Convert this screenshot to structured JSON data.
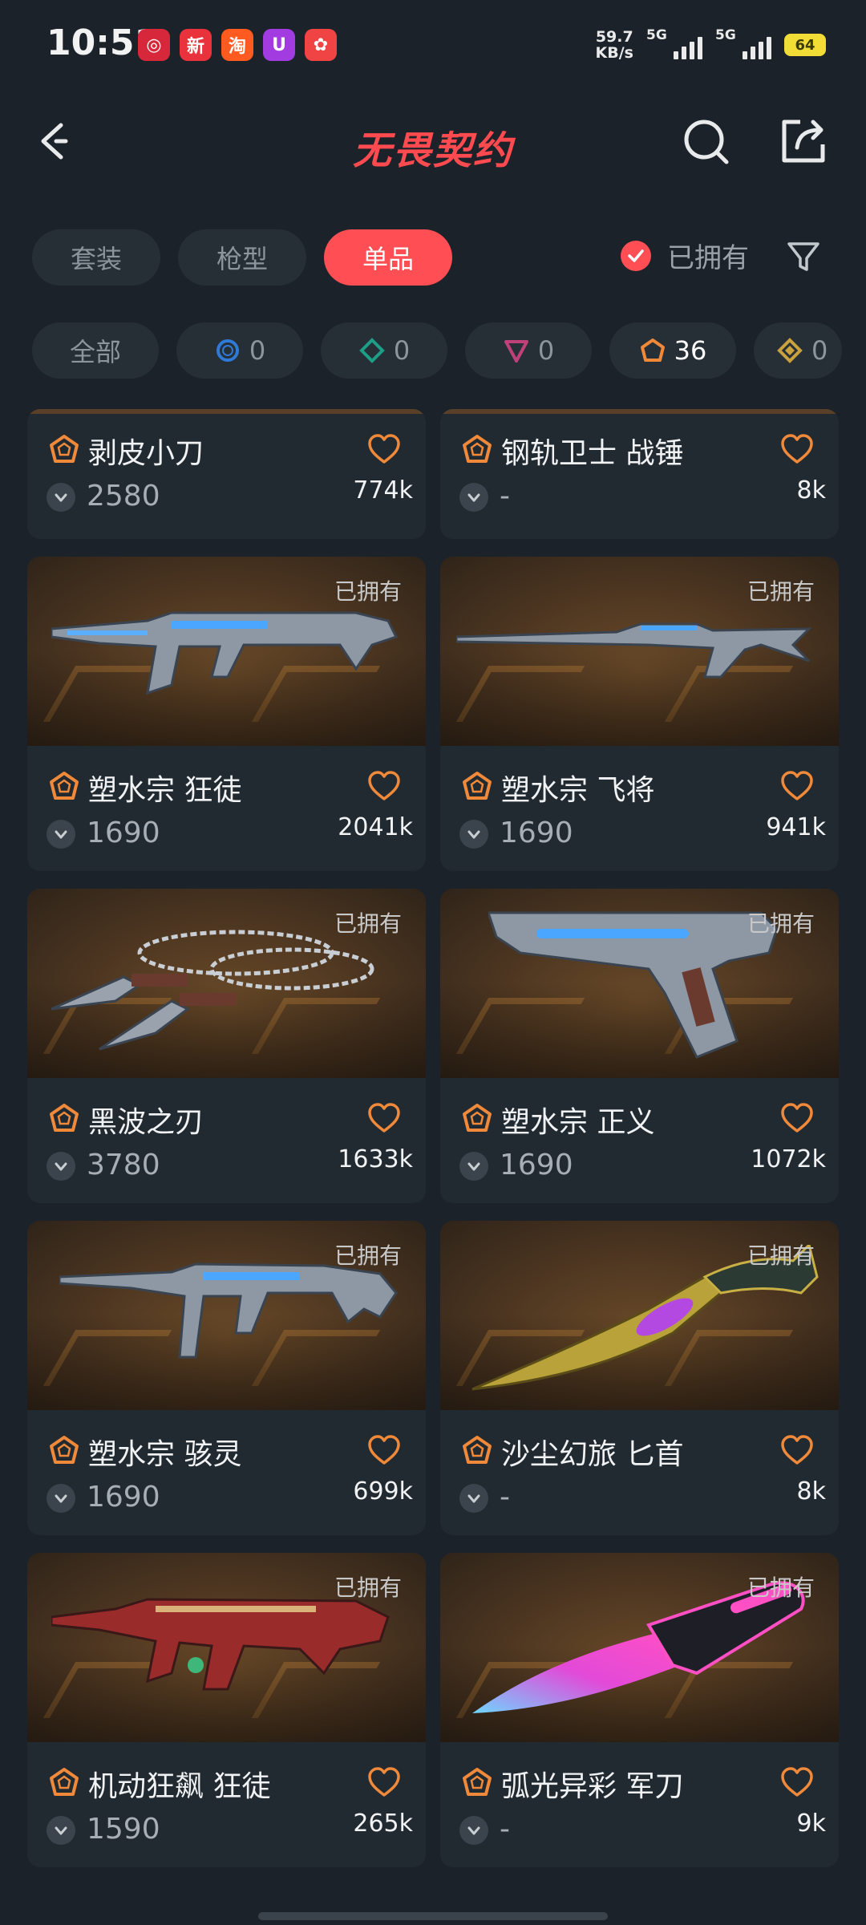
{
  "status_bar": {
    "time": "10:51",
    "apps": [
      {
        "name": "bank-app-icon",
        "glyph": "◎",
        "color": "#d6283a"
      },
      {
        "name": "news-app-icon",
        "glyph": "新",
        "color": "#e9323b"
      },
      {
        "name": "taobao-app-icon",
        "glyph": "淘",
        "color": "#ff5a1f"
      },
      {
        "name": "u-app-icon",
        "glyph": "U",
        "color": "#a23be0"
      },
      {
        "name": "game-app-icon",
        "glyph": "✿",
        "color": "#f04343"
      }
    ],
    "net_speed_value": "59.7",
    "net_speed_unit": "KB/s",
    "signal_1_label": "5G",
    "signal_2_label": "5G",
    "battery": "64"
  },
  "header": {
    "title": "无畏契约"
  },
  "type_tabs": [
    "套装",
    "枪型",
    "单品"
  ],
  "active_type_tab": 2,
  "owned_filter_label": "已拥有",
  "tier_chips": [
    {
      "label": "全部",
      "icon": "",
      "count": ""
    },
    {
      "label": "",
      "icon": "select-tier-icon",
      "color": "#2f7ad6",
      "count": "0"
    },
    {
      "label": "",
      "icon": "deluxe-tier-icon",
      "color": "#1d9e86",
      "count": "0"
    },
    {
      "label": "",
      "icon": "premium-tier-icon",
      "color": "#c0417a",
      "count": "0"
    },
    {
      "label": "",
      "icon": "exclusive-tier-icon",
      "color": "#f08a3a",
      "count": "36"
    },
    {
      "label": "",
      "icon": "ultra-tier-icon",
      "color": "#c9a23e",
      "count": "0"
    }
  ],
  "items": [
    {
      "name": "剥皮小刀",
      "price": "2580",
      "favorites": "774k",
      "owned_label": ""
    },
    {
      "name": "钢轨卫士 战锤",
      "price": "-",
      "favorites": "8k",
      "owned_label": ""
    },
    {
      "name": "塑水宗 狂徒",
      "price": "1690",
      "favorites": "2041k",
      "owned_label": "已拥有",
      "art": "rifle"
    },
    {
      "name": "塑水宗 飞将",
      "price": "1690",
      "favorites": "941k",
      "owned_label": "已拥有",
      "art": "sniper"
    },
    {
      "name": "黑波之刃",
      "price": "3780",
      "favorites": "1633k",
      "owned_label": "已拥有",
      "art": "kunai"
    },
    {
      "name": "塑水宗 正义",
      "price": "1690",
      "favorites": "1072k",
      "owned_label": "已拥有",
      "art": "pistol"
    },
    {
      "name": "塑水宗 骇灵",
      "price": "1690",
      "favorites": "699k",
      "owned_label": "已拥有",
      "art": "smg"
    },
    {
      "name": "沙尘幻旅 匕首",
      "price": "-",
      "favorites": "8k",
      "owned_label": "已拥有",
      "art": "dagger"
    },
    {
      "name": "机动狂飙 狂徒",
      "price": "1590",
      "favorites": "265k",
      "owned_label": "已拥有",
      "art": "redrifle"
    },
    {
      "name": "弧光异彩 军刀",
      "price": "-",
      "favorites": "9k",
      "owned_label": "已拥有",
      "art": "pinkknife"
    }
  ]
}
